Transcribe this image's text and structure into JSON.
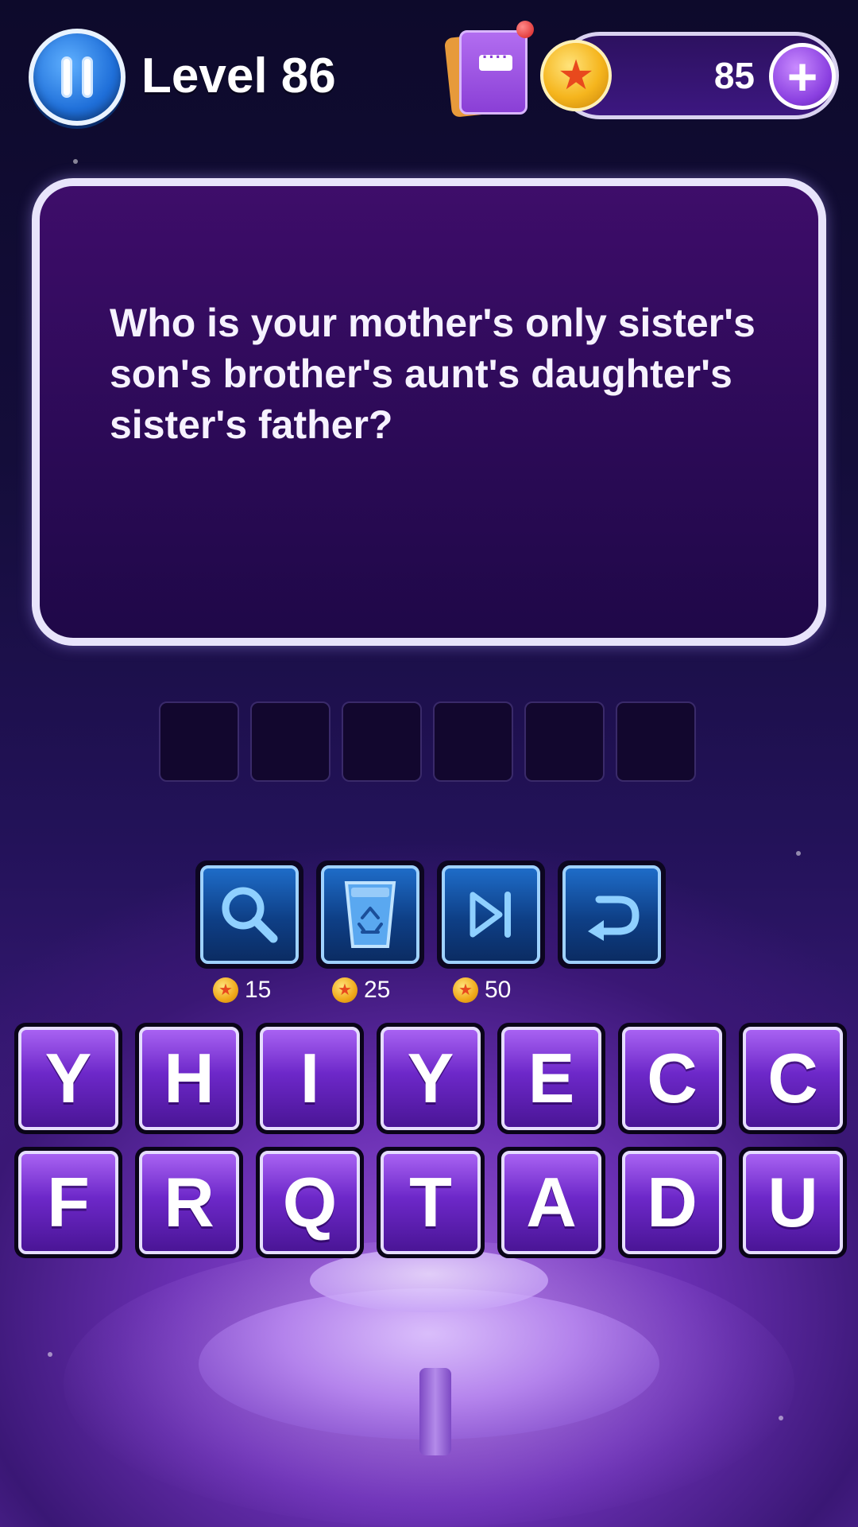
{
  "header": {
    "level_label": "Level 86",
    "coins": "85",
    "icons": {
      "pause": "pause-icon",
      "book": "book-icon",
      "coin": "coin-icon",
      "add": "plus-icon"
    }
  },
  "question": {
    "text": "Who is your mother's only sister's son's brother's aunt's daughter's sister's father?"
  },
  "answer": {
    "slot_count": 6,
    "letters": [
      "",
      "",
      "",
      "",
      "",
      ""
    ]
  },
  "powerups": [
    {
      "name": "hint",
      "icon": "magnifier-icon",
      "cost": "15"
    },
    {
      "name": "remove",
      "icon": "recycle-bin-icon",
      "cost": "25"
    },
    {
      "name": "skip",
      "icon": "skip-icon",
      "cost": "50"
    },
    {
      "name": "undo",
      "icon": "undo-arrow-icon",
      "cost": ""
    }
  ],
  "keyboard": {
    "row1": [
      "Y",
      "H",
      "I",
      "Y",
      "E",
      "C",
      "C"
    ],
    "row2": [
      "F",
      "R",
      "Q",
      "T",
      "A",
      "D",
      "U"
    ]
  },
  "colors": {
    "accent_purple": "#6d28c9",
    "powerup_blue": "#1e6cc8",
    "panel_border": "#e8e4fb",
    "coin_gold": "#f5b51d"
  }
}
